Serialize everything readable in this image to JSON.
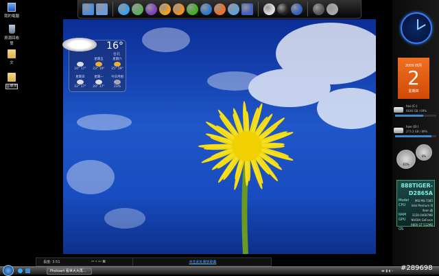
{
  "desktop_icons": [
    {
      "label": "我的電腦"
    },
    {
      "label": "資源回收筒"
    },
    {
      "label": "文"
    },
    {
      "label": "音樂夾"
    }
  ],
  "dock": {
    "icons": [
      "computer-icon",
      "network-icon",
      "internet-explorer-icon",
      "messenger-icon",
      "yahoo-messenger-icon",
      "smiley-icon",
      "green-app-icon",
      "monitor-icon",
      "qq-icon",
      "itunes-icon",
      "app-icon",
      "blank-document-icon",
      "pirate-icon",
      "globe-icon",
      "crazy-app-icon",
      "settings-icon",
      "recycle-bin-icon"
    ]
  },
  "weather": {
    "temp": "16°",
    "city": "台北",
    "days": [
      {
        "label": "",
        "temps": "16° 17°"
      },
      {
        "label": "星期五",
        "temps": "23° 19°"
      },
      {
        "label": "星期六",
        "temps": "25° 19°"
      },
      {
        "label": "星期日",
        "temps": "22° 17°"
      },
      {
        "label": "星期一",
        "temps": "20° 17°"
      },
      {
        "label": "今日月相",
        "temps": "23%"
      }
    ]
  },
  "calendar": {
    "header": "2009 四月",
    "day": "2",
    "weekday": "星期四"
  },
  "drives": [
    {
      "name": "hai (C:)",
      "info": "6646 GB / 69%",
      "fill": 0.69
    },
    {
      "name": "han (D:)",
      "info": "273.3 GB / 89%",
      "fill": 0.89
    }
  ],
  "gauges": [
    {
      "label": "63%"
    },
    {
      "label": "0%"
    }
  ],
  "sysinfo": {
    "hostname": "888TIGER-D2865A",
    "rows": [
      {
        "k": "Model",
        "v": "MSI MS-7385"
      },
      {
        "k": "CPU",
        "v": "Intel Pentium III Xeon 處"
      },
      {
        "k": "RAM",
        "v": "3328.04687MB"
      },
      {
        "k": "GPU",
        "v": "NVIDIA GeForce 9800 GT 512MB"
      },
      {
        "k": "OS",
        "v": ""
      }
    ]
  },
  "media": {
    "title": "長度: 3:51",
    "link": "点击此处播放歌曲"
  },
  "taskbar": {
    "task": "Photoart 看世大大再...",
    "tag": "#289698"
  }
}
